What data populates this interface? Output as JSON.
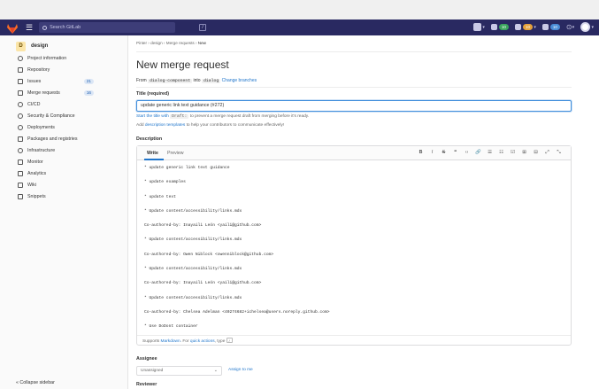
{
  "navbar": {
    "search_placeholder": "Search GitLab",
    "slash_key": "/",
    "merge_count": "10",
    "issues_count": "10",
    "todo_count": "10",
    "colors": {
      "bg": "#292961",
      "merge_badge": "#3aa55d",
      "issues_badge": "#e6a23c",
      "todo_badge": "#4a8cd6"
    }
  },
  "sidebar": {
    "project_initial": "D",
    "project_name": "design",
    "items": [
      {
        "label": "Project information",
        "icon": "info-icon"
      },
      {
        "label": "Repository",
        "icon": "book-icon"
      },
      {
        "label": "Issues",
        "icon": "issues-icon",
        "count": "21"
      },
      {
        "label": "Merge requests",
        "icon": "merge-icon",
        "count": "16"
      },
      {
        "label": "CI/CD",
        "icon": "rocket-icon"
      },
      {
        "label": "Security & Compliance",
        "icon": "shield-icon"
      },
      {
        "label": "Deployments",
        "icon": "deploy-icon"
      },
      {
        "label": "Packages and registries",
        "icon": "package-icon"
      },
      {
        "label": "Infrastructure",
        "icon": "cloud-icon"
      },
      {
        "label": "Monitor",
        "icon": "monitor-icon"
      },
      {
        "label": "Analytics",
        "icon": "chart-icon"
      },
      {
        "label": "Wiki",
        "icon": "wiki-icon"
      },
      {
        "label": "Snippets",
        "icon": "scissors-icon"
      }
    ],
    "collapse_label": "Collapse sidebar"
  },
  "breadcrumb": {
    "items": [
      "Pinter",
      "design",
      "Merge requests"
    ],
    "current": "New"
  },
  "page": {
    "title": "New merge request",
    "from_text": "From",
    "source_branch": "dialog-component",
    "into_text": "into",
    "target_branch": "dialog",
    "change_branches": "Change branches"
  },
  "form": {
    "title_label": "Title (required)",
    "title_value": "update generic link text guidance (#272)",
    "hint_start": "Start the title with",
    "draft_code": "Draft:",
    "hint_rest": "to prevent a merge request draft from merging before it's ready.",
    "add_text": "Add",
    "templates_link": "description templates",
    "add_rest": "to help your contributors to communicate effectively!",
    "description_label": "Description",
    "tab_write": "Write",
    "tab_preview": "Preview",
    "toolbar": [
      "B",
      "I",
      "S",
      "❝",
      "‹›",
      "🔗",
      "☰",
      "☷",
      "☑",
      "⊞",
      "⊟",
      "⤢",
      "⤡"
    ],
    "description_lines": [
      "* update generic link text guidance",
      "* update examples",
      "* update text",
      "* Update content/accessibility/links.mdx",
      "Co-authored-by: Inayaili León <yaili@github.com>",
      "* Update content/accessibility/links.mdx",
      "Co-authored-by: Owen Niblock <owenniblock@github.com>",
      "* Update content/accessibility/links.mdx",
      "Co-authored-by: Inayaili León <yaili@github.com>",
      "* Update content/accessibility/links.mdx",
      "Co-authored-by: Chelsea Adelman <40274682+ichelsea@users.noreply.github.com>",
      "* Use DoDont container"
    ],
    "supports_text": "Supports",
    "markdown_link": "Markdown",
    "for_text": ". For",
    "quick_actions_link": "quick actions",
    "type_text": ", type",
    "kbd_slash": "/",
    "assignee_label": "Assignee",
    "assignee_value": "Unassigned",
    "assign_me": "Assign to me",
    "reviewer_label": "Reviewer"
  }
}
